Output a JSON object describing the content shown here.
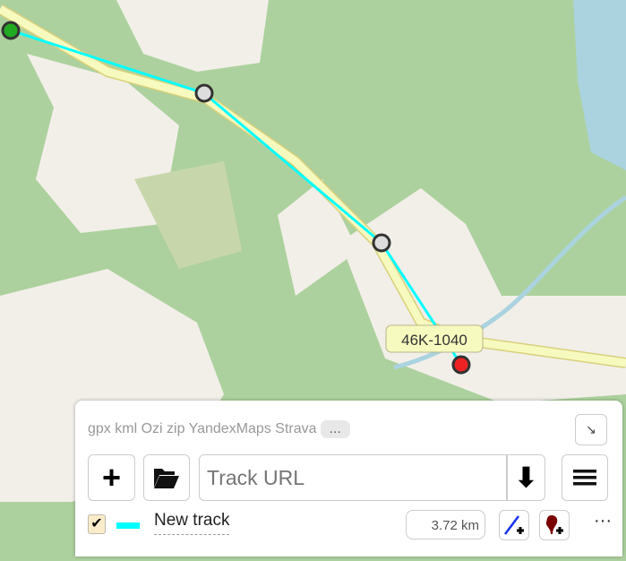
{
  "map": {
    "road_label": "46K-1040",
    "colors": {
      "forest": "#add19e",
      "land": "#f2efe9",
      "road": "#f7fabf",
      "track": "#00ffff",
      "start": "#22aa22",
      "end": "#ee2222"
    }
  },
  "panel": {
    "formats": "gpx kml Ozi zip YandexMaps Strava",
    "more_label": "...",
    "url_placeholder": "Track URL",
    "track": {
      "checked": true,
      "name": "New track",
      "length": "3.72 km",
      "color": "#00ffff"
    },
    "more_actions": "···"
  }
}
